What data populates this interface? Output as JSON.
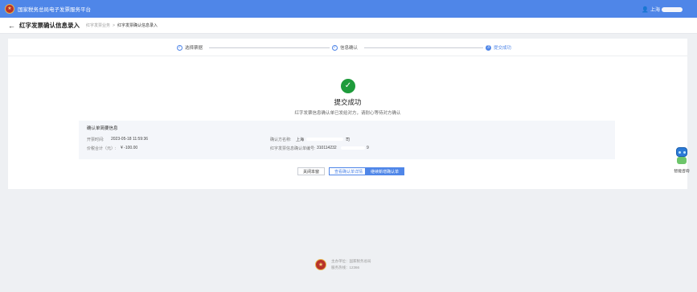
{
  "header": {
    "app_title": "国家税务总局电子发票服务平台",
    "emblem_icon": "tax-emblem-icon",
    "user_prefix": "上海"
  },
  "subheader": {
    "back_icon": "←",
    "title": "红字发票确认信息录入",
    "breadcrumb": [
      "红字发票业务",
      "红字发票确认信息录入"
    ],
    "breadcrumb_sep": ">"
  },
  "steps": [
    {
      "index": "✓",
      "label": "选择票据",
      "state": "done"
    },
    {
      "index": "✓",
      "label": "信息确认",
      "state": "done"
    },
    {
      "index": "3",
      "label": "提交成功",
      "state": "active"
    }
  ],
  "result": {
    "icon": "✓",
    "title": "提交成功",
    "description": "红字发票信息确认单已发给对方，请耐心等待对方确认"
  },
  "info": {
    "title": "确认单简要信息",
    "open_time_label": "开票时间:",
    "open_time_value": "2023-05-18 11:59:36",
    "tax_total_label": "价税合计（元）:",
    "tax_total_value": "¥ -100.00",
    "confirmer_label": "确认方名称:",
    "confirmer_prefix": "上海",
    "confirmer_suffix": "司",
    "confirm_no_label": "红字发票信息确认单编号:",
    "confirm_no_value": "310114232",
    "confirm_no_suffix": "9"
  },
  "buttons": {
    "close": "关闭本窗",
    "view_detail": "查看确认单详情",
    "continue_new": "继续新增确认单"
  },
  "assistant": {
    "label": "智能咨询"
  },
  "footer": {
    "line1": "主办单位：国家税务总局",
    "line2": "服务热线：12366"
  },
  "colors": {
    "brand_blue": "#4f86e8",
    "success_green": "#1e9b3b",
    "emblem_red": "#b8322a"
  }
}
